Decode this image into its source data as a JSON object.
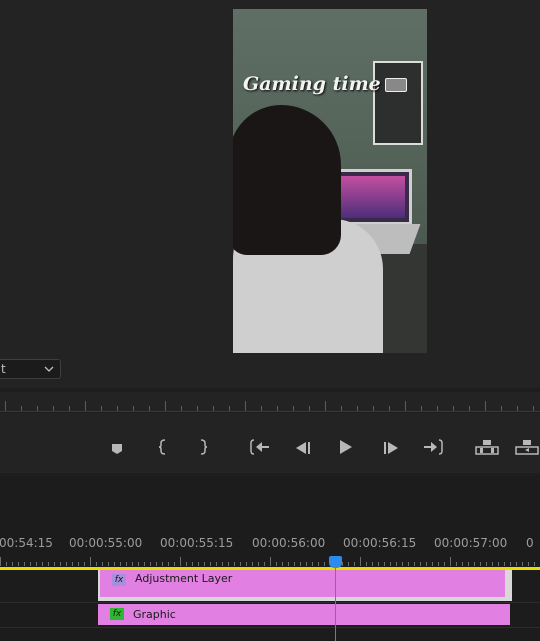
{
  "program_monitor": {
    "frame_overlay_text": "Gaming time",
    "fit_select": "t"
  },
  "transport": {
    "buttons": [
      {
        "name": "add-marker-button",
        "icon": "marker-icon"
      },
      {
        "name": "mark-in-button",
        "icon": "mark-in-icon"
      },
      {
        "name": "mark-out-button",
        "icon": "mark-out-icon"
      },
      {
        "name": "go-to-in-button",
        "icon": "go-to-in-icon"
      },
      {
        "name": "step-back-button",
        "icon": "step-back-icon"
      },
      {
        "name": "play-button",
        "icon": "play-icon"
      },
      {
        "name": "step-forward-button",
        "icon": "step-forward-icon"
      },
      {
        "name": "go-to-out-button",
        "icon": "go-to-out-icon"
      },
      {
        "name": "lift-button",
        "icon": "lift-icon"
      },
      {
        "name": "extract-button",
        "icon": "extract-icon"
      }
    ]
  },
  "timeline": {
    "timecodes": [
      "00:54:15",
      "00:00:55:00",
      "00:00:55:15",
      "00:00:56:00",
      "00:00:56:15",
      "00:00:57:00",
      "0"
    ],
    "tracks": [
      {
        "clip_label": "Adjustment Layer",
        "fx_color": "#a68fdc"
      },
      {
        "clip_label": "Graphic",
        "fx_color": "#2fb52f"
      }
    ],
    "fx_label": "fx",
    "clip_color": "#e27fe2",
    "playhead_color": "#2d8ceb",
    "work_area_color": "#e8dd00"
  }
}
